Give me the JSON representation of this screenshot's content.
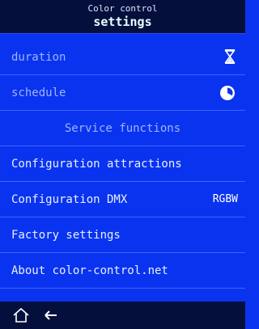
{
  "header": {
    "line1": "Color control",
    "line2": "settings"
  },
  "rows": {
    "duration": {
      "label": "duration",
      "icon": "hourglass-icon"
    },
    "schedule": {
      "label": "schedule",
      "icon": "clock-pie-icon"
    },
    "section": {
      "label": "Service functions"
    },
    "config_attractions": {
      "label": "Configuration attractions"
    },
    "config_dmx": {
      "label": "Configuration DMX",
      "value": "RGBW"
    },
    "factory": {
      "label": "Factory settings"
    },
    "about": {
      "label": "About color-control.net"
    }
  },
  "footer": {
    "home_icon": "home-icon",
    "back_icon": "back-arrow-icon"
  },
  "colors": {
    "background": "#0a33f0",
    "header": "#050f3c",
    "text": "#e7f0ff",
    "dim_text": "#9eb4ff"
  }
}
